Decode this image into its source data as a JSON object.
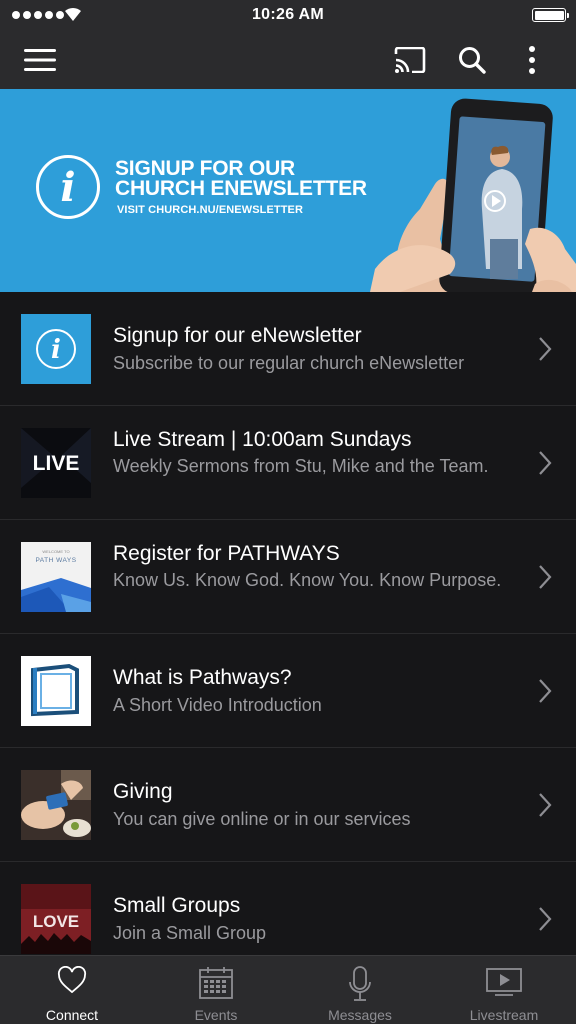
{
  "status_bar": {
    "time": "10:26 AM"
  },
  "nav": {
    "icons": [
      "menu-icon",
      "cast-icon",
      "search-icon",
      "more-vertical-icon"
    ]
  },
  "banner": {
    "title_line1": "SIGNUP FOR OUR",
    "title_line2": "CHURCH ENEWSLETTER",
    "subtitle": "VISIT CHURCH.NU/ENEWSLETTER",
    "info_glyph": "i",
    "color": "#2e9ed9"
  },
  "list": [
    {
      "title": "Signup for our eNewsletter",
      "subtitle": "Subscribe to our regular church eNewsletter",
      "thumb": "info"
    },
    {
      "title": "Live Stream | 10:00am Sundays",
      "subtitle": "Weekly Sermons from Stu, Mike and the Team.",
      "thumb": "live",
      "thumb_text": "LIVE"
    },
    {
      "title": "Register for PATHWAYS",
      "subtitle": "Know Us. Know God. Know You. Know Purpose.",
      "thumb": "pathways",
      "thumb_text_small": "WELCOME TO",
      "thumb_text": "PATH WAYS"
    },
    {
      "title": "What is Pathways?",
      "subtitle": "A Short Video Introduction",
      "thumb": "pathways-logo"
    },
    {
      "title": "Giving",
      "subtitle": "You can give online or in our services",
      "thumb": "giving"
    },
    {
      "title": "Small Groups",
      "subtitle": "Join a Small Group",
      "thumb": "love",
      "thumb_text": "LOVE"
    }
  ],
  "tabs": [
    {
      "label": "Connect",
      "icon": "heart-icon",
      "active": true
    },
    {
      "label": "Events",
      "icon": "calendar-icon",
      "active": false
    },
    {
      "label": "Messages",
      "icon": "microphone-icon",
      "active": false
    },
    {
      "label": "Livestream",
      "icon": "play-screen-icon",
      "active": false
    }
  ]
}
